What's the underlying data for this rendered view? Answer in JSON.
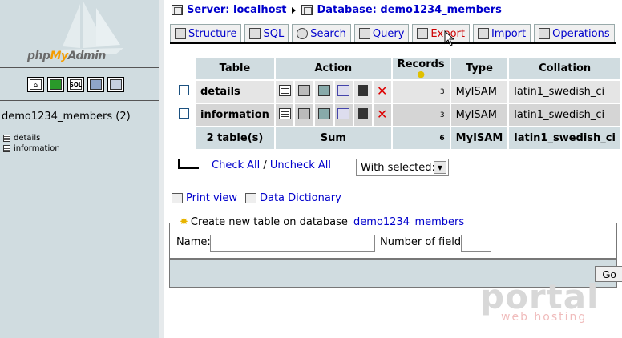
{
  "logo": {
    "part1": "php",
    "part2": "My",
    "part3": "Admin"
  },
  "left": {
    "icons": [
      "home-icon",
      "query-window-icon",
      "sql-icon",
      "docs-icon",
      "help-icon"
    ],
    "icon_labels": [
      "",
      "",
      "SQL",
      "",
      ""
    ],
    "db_title": "demo1234_members (2)",
    "tables": [
      "details",
      "information"
    ]
  },
  "breadcrumb": {
    "server_label": "Server: localhost",
    "db_label": "Database: demo1234_members"
  },
  "tabs": [
    {
      "label": "Structure"
    },
    {
      "label": "SQL"
    },
    {
      "label": "Search"
    },
    {
      "label": "Query"
    },
    {
      "label": "Export"
    },
    {
      "label": "Import"
    },
    {
      "label": "Operations"
    }
  ],
  "active_tab": "Export",
  "table": {
    "headers": {
      "table": "Table",
      "action": "Action",
      "records": "Records",
      "type": "Type",
      "collation": "Collation"
    },
    "rows": [
      {
        "name": "details",
        "records": "3",
        "type": "MyISAM",
        "collation": "latin1_swedish_ci"
      },
      {
        "name": "information",
        "records": "3",
        "type": "MyISAM",
        "collation": "latin1_swedish_ci"
      }
    ],
    "summary": {
      "tables": "2 table(s)",
      "sum": "Sum",
      "records": "6",
      "type": "MyISAM",
      "collation": "latin1_swedish_ci"
    }
  },
  "check": {
    "check_all": "Check All",
    "sep": " / ",
    "uncheck_all": "Uncheck All",
    "with_selected": "With selected:"
  },
  "links": {
    "print_view": "Print view",
    "data_dictionary": "Data Dictionary"
  },
  "create": {
    "legend_prefix": "Create new table on database ",
    "legend_db": "demo1234_members",
    "name_label": "Name:",
    "name_value": "",
    "fields_label": "Number of fields:",
    "fields_value": "",
    "go_label": "Go"
  },
  "watermark": {
    "big": "portal",
    "small": "web hosting"
  },
  "colors": {
    "link": "#0000cc",
    "active_tab": "#cc0000",
    "header_bg": "#d0dce0",
    "left_bg": "#d0dce0"
  }
}
